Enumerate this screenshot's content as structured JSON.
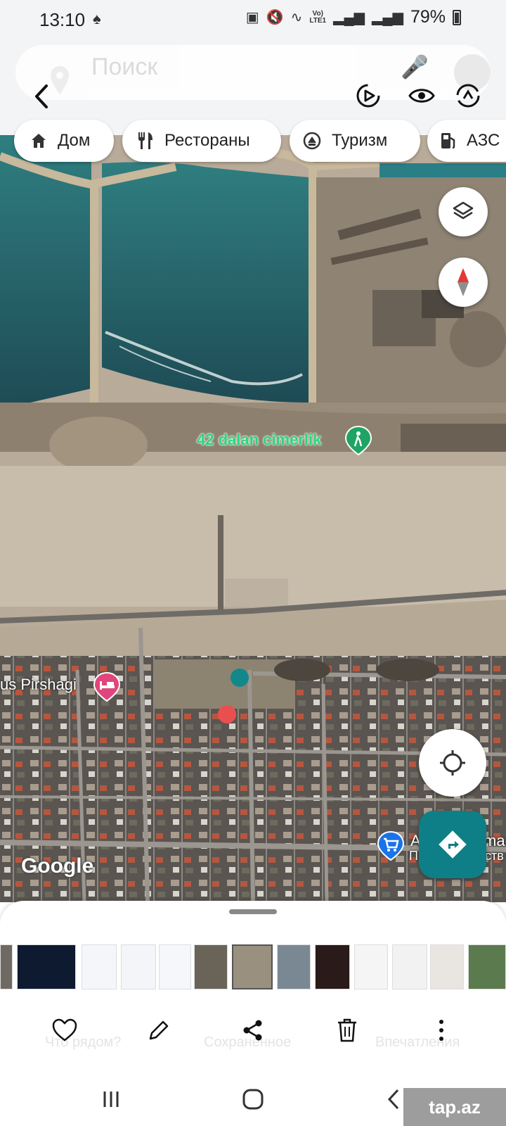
{
  "status_bar": {
    "time": "13:10",
    "network_top": "Vo)",
    "network_bottom": "LTE1",
    "battery": "79%"
  },
  "search": {
    "placeholder": "Поиск"
  },
  "chips": [
    {
      "label": "Дом",
      "icon": "home-icon"
    },
    {
      "label": "Рестораны",
      "icon": "restaurant-icon"
    },
    {
      "label": "Туризм",
      "icon": "tourism-icon"
    },
    {
      "label": "АЗС",
      "icon": "gas-station-icon"
    }
  ],
  "map": {
    "labels": {
      "poi_beach": "42 dalan cimerlik",
      "poi_hotel": "us Pirshagi",
      "poi_shop": "A",
      "poi_shop_tail": "ma",
      "poi_shop_sub": "П",
      "poi_shop_sub_tail": "ств"
    },
    "watermark": "Google"
  },
  "sheet": {
    "faded_labels": {
      "nearby": "Что рядом?",
      "saved": "Сохраненное",
      "impressions": "Впечатления"
    }
  },
  "watermark": "tap.az",
  "colors": {
    "accent_teal": "#0e7f86",
    "poi_green": "#1fa463",
    "poi_pink": "#e0457b",
    "poi_blue": "#1a73e8"
  }
}
